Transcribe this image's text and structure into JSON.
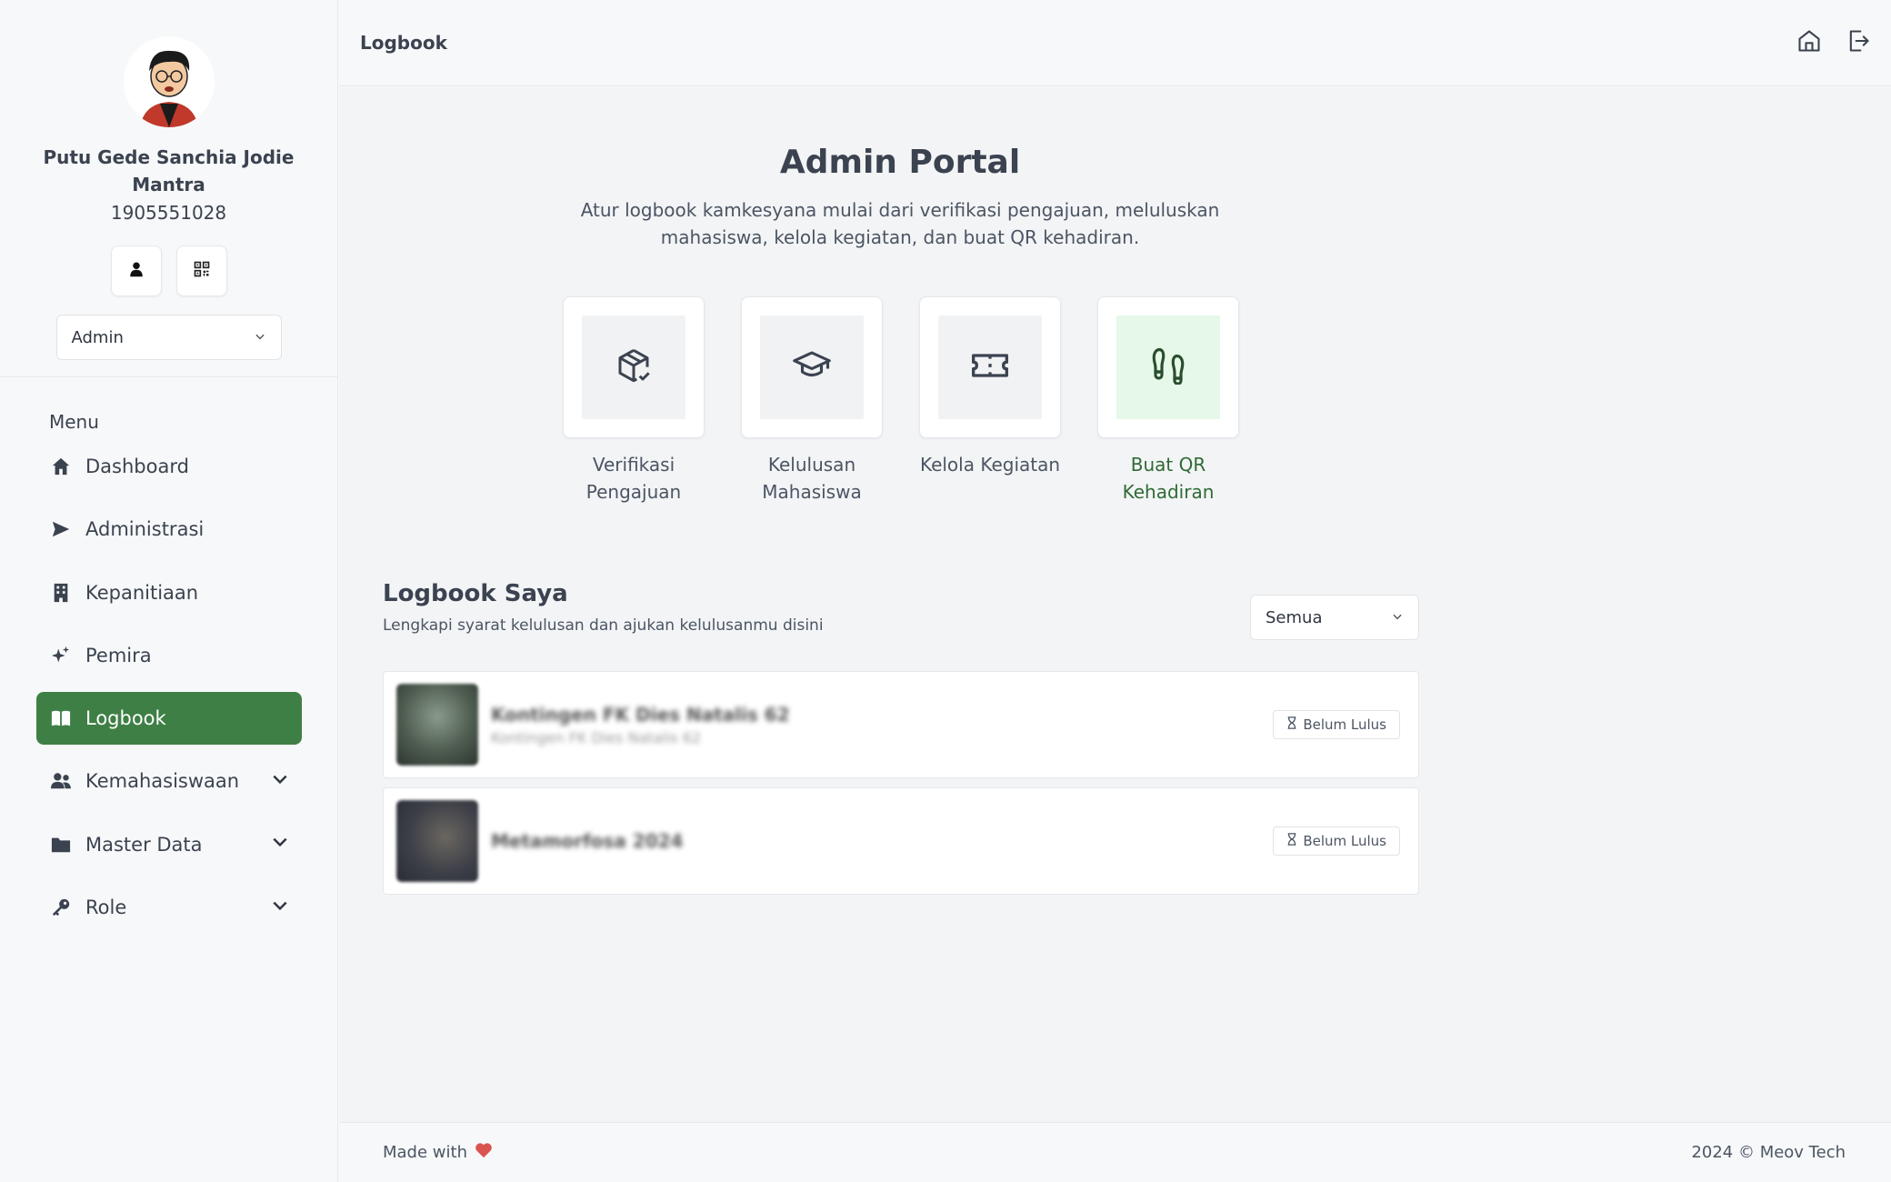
{
  "app": {
    "page_title": "Logbook"
  },
  "profile": {
    "name": "Putu Gede Sanchia Jodie Mantra",
    "id": "1905551028",
    "role": "Admin"
  },
  "menu": {
    "title": "Menu",
    "items": [
      {
        "label": "Dashboard",
        "icon": "home-icon",
        "active": false,
        "expandable": false
      },
      {
        "label": "Administrasi",
        "icon": "send-icon",
        "active": false,
        "expandable": false
      },
      {
        "label": "Kepanitiaan",
        "icon": "building-icon",
        "active": false,
        "expandable": false
      },
      {
        "label": "Pemira",
        "icon": "sparkles-icon",
        "active": false,
        "expandable": false
      },
      {
        "label": "Logbook",
        "icon": "book-icon",
        "active": true,
        "expandable": false
      },
      {
        "label": "Kemahasiswaan",
        "icon": "users-icon",
        "active": false,
        "expandable": true
      },
      {
        "label": "Master Data",
        "icon": "folder-icon",
        "active": false,
        "expandable": true
      },
      {
        "label": "Role",
        "icon": "key-icon",
        "active": false,
        "expandable": true
      }
    ]
  },
  "portal": {
    "title": "Admin Portal",
    "description": "Atur logbook kamkesyana mulai dari verifikasi pengajuan, meluluskan mahasiswa, kelola kegiatan, dan buat QR kehadiran.",
    "actions": [
      {
        "label": "Verifikasi Pengajuan",
        "icon": "package-check-icon"
      },
      {
        "label": "Kelulusan Mahasiswa",
        "icon": "graduation-cap-icon"
      },
      {
        "label": "Kelola Kegiatan",
        "icon": "ticket-icon"
      },
      {
        "label": "Buat QR Kehadiran",
        "icon": "footprints-icon",
        "highlight": true
      }
    ]
  },
  "logbook": {
    "title": "Logbook Saya",
    "subtitle": "Lengkapi syarat kelulusan dan ajukan kelulusanmu disini",
    "filter": "Semua",
    "entries": [
      {
        "title": "Kontingen FK Dies Natalis 62",
        "subtitle": "Kontingen FK Dies Natalis 62",
        "status": "Belum Lulus"
      },
      {
        "title": "Metamorfosa 2024",
        "subtitle": "",
        "status": "Belum Lulus"
      }
    ]
  },
  "footer": {
    "made_with": "Made with",
    "copyright": "2024 © Meov Tech"
  },
  "colors": {
    "accent": "#3e7f45",
    "heart": "#d9534f",
    "highlight_bg": "#e6f8e8"
  }
}
